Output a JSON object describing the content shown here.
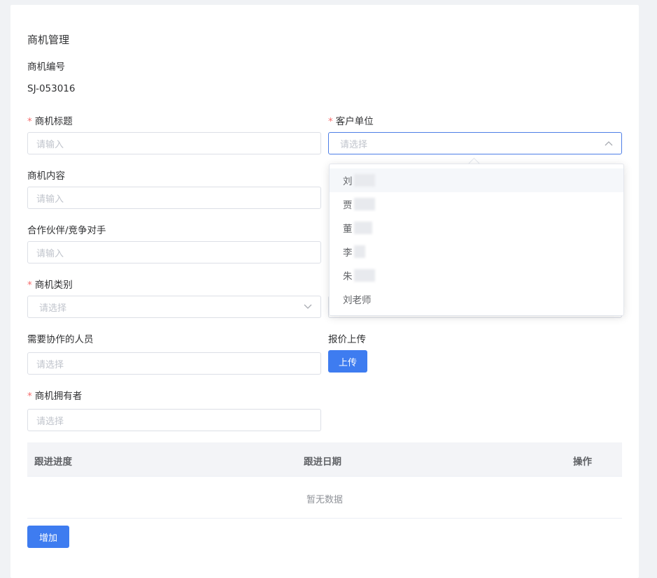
{
  "page": {
    "title": "商机管理"
  },
  "form": {
    "code": {
      "label": "商机编号",
      "value": "SJ-053016"
    },
    "subject": {
      "label": "商机标题",
      "required": "*",
      "placeholder": "请输入"
    },
    "customer": {
      "label": "客户单位",
      "required": "*",
      "placeholder": "请选择",
      "arrow_icon": "chevron-up-icon"
    },
    "content": {
      "label": "商机内容",
      "placeholder": "请输入"
    },
    "partner": {
      "label": "合作伙伴/竞争对手",
      "placeholder": "请输入"
    },
    "category": {
      "label": "商机类别",
      "required": "*",
      "placeholder": "请选择",
      "arrow_icon": "chevron-down-icon"
    },
    "collaborators": {
      "label": "需要协作的人员",
      "placeholder": "请选择"
    },
    "quote": {
      "label": "报价上传",
      "button": "上传"
    },
    "owner": {
      "label": "商机拥有者",
      "required": "*",
      "placeholder": "请选择"
    }
  },
  "customer_dropdown": {
    "options": [
      {
        "label": "刘",
        "redacted": true
      },
      {
        "label": "贾",
        "redacted": true
      },
      {
        "label": "董",
        "redacted": true
      },
      {
        "label": "李",
        "redacted": true
      },
      {
        "label": "朱",
        "redacted": true
      },
      {
        "label": "刘老师",
        "redacted": false
      }
    ]
  },
  "followup_table": {
    "columns": [
      "跟进进度",
      "跟进日期",
      "操作"
    ],
    "empty_text": "暂无数据"
  },
  "actions": {
    "add_button": "增加"
  },
  "colors": {
    "primary": "#3e7cf0",
    "required": "#f56c6c",
    "focus_border": "#4d7ee6"
  }
}
